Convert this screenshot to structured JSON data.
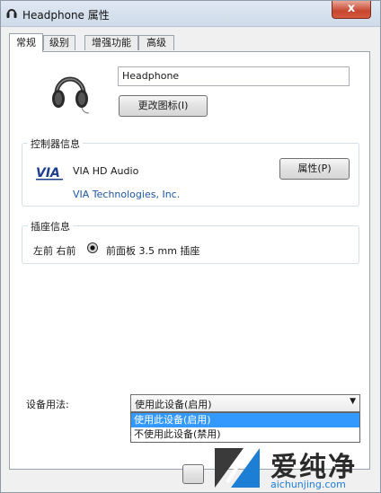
{
  "window": {
    "title": "Headphone 属性",
    "close_label": "x",
    "icon": "headphone-icon"
  },
  "tabs": [
    {
      "label": "常规",
      "active": true
    },
    {
      "label": "级别",
      "active": false
    },
    {
      "label": "增强功能",
      "active": false
    },
    {
      "label": "高级",
      "active": false
    }
  ],
  "general": {
    "device_name": "Headphone",
    "change_icon_button": "更改图标(I)",
    "device_icon": "headphones-icon"
  },
  "controller": {
    "group_title": "控制器信息",
    "name": "VIA HD Audio",
    "vendor": "VIA Technologies, Inc.",
    "properties_button": "属性(P)",
    "logo_icon": "via-logo-icon",
    "logo_text": "VIA"
  },
  "jack": {
    "group_title": "插座信息",
    "position": "左前 右前",
    "description": "前面板 3.5 mm 插座",
    "icon": "audio-jack-icon"
  },
  "usage": {
    "label": "设备用法:",
    "selected": "使用此设备(启用)",
    "options": [
      "使用此设备(启用)",
      "不使用此设备(禁用)"
    ]
  },
  "watermark": {
    "brand": "爱纯净",
    "url": "aichunjing.com",
    "color": "#1d7ed6"
  },
  "colors": {
    "selection": "#3399ff",
    "link": "#1e56a6",
    "close_button": "#c7462f"
  }
}
